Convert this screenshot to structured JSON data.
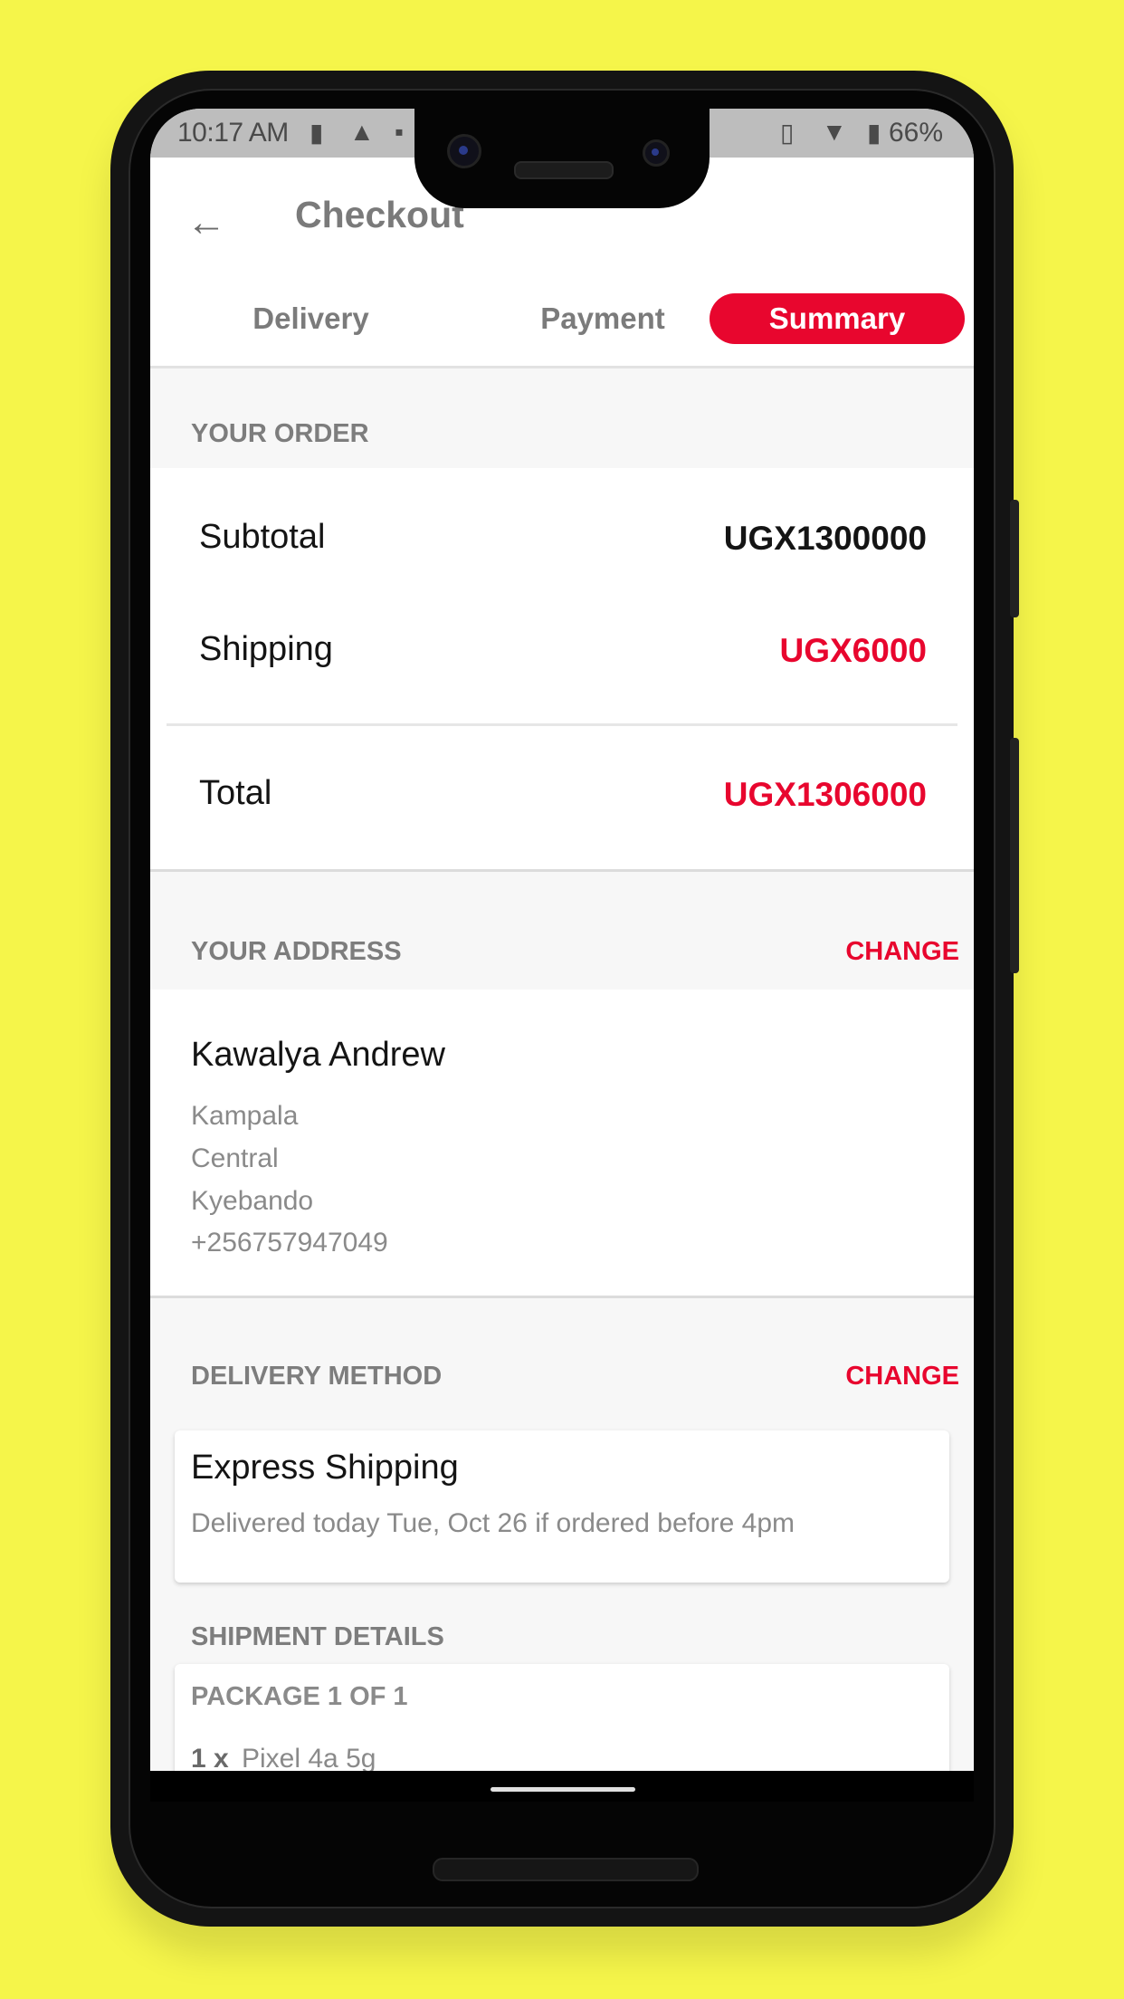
{
  "status_bar": {
    "time": "10:17 AM",
    "battery": "66%",
    "icons": [
      "sim-icon",
      "alert-icon",
      "app-notification-icon",
      "vibrate-icon",
      "wifi-icon",
      "battery-icon"
    ]
  },
  "app_bar": {
    "title": "Checkout",
    "back_icon": "arrow-left-icon"
  },
  "tabs": [
    {
      "label": "Delivery",
      "active": false
    },
    {
      "label": "Payment",
      "active": false
    },
    {
      "label": "Summary",
      "active": true
    }
  ],
  "order": {
    "header": "YOUR ORDER",
    "subtotal_label": "Subtotal",
    "subtotal_value": "UGX1300000",
    "shipping_label": "Shipping",
    "shipping_value": "UGX6000",
    "total_label": "Total",
    "total_value": "UGX1306000"
  },
  "address": {
    "header": "YOUR ADDRESS",
    "change_label": "CHANGE",
    "name": "Kawalya Andrew",
    "lines": [
      "Kampala",
      "Central",
      "Kyebando",
      "+256757947049"
    ]
  },
  "delivery_method": {
    "header": "DELIVERY METHOD",
    "change_label": "CHANGE",
    "title": "Express Shipping",
    "subtitle": "Delivered today Tue, Oct 26 if ordered before 4pm"
  },
  "shipment": {
    "header": "SHIPMENT DETAILS",
    "package_label": "PACKAGE 1 OF 1",
    "items": [
      {
        "qty": "1 x",
        "name": "Pixel 4a 5g"
      }
    ]
  },
  "colors": {
    "accent": "#E8062E",
    "background": "#F5F54A"
  }
}
